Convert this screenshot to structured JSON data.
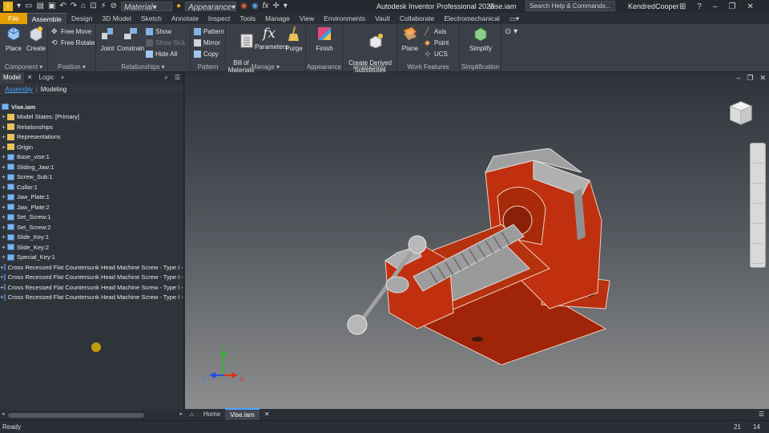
{
  "titlebar": {
    "material": "Material",
    "appearance": "Appearance",
    "app_title": "Autodesk Inventor Professional 2025",
    "file_title": "Vise.iam",
    "search_placeholder": "Search Help & Commands...",
    "user": "KendredCooper"
  },
  "ribbon_tabs": [
    "File",
    "Assemble",
    "Design",
    "3D Model",
    "Sketch",
    "Annotate",
    "Inspect",
    "Tools",
    "Manage",
    "View",
    "Environments",
    "Vault",
    "Collaborate",
    "Electromechanical"
  ],
  "ribbon": {
    "component": {
      "label": "Component",
      "place": "Place",
      "create": "Create"
    },
    "position": {
      "label": "Position",
      "free_move": "Free Move",
      "free_rotate": "Free Rotate"
    },
    "relationships": {
      "label": "Relationships",
      "joint": "Joint",
      "constrain": "Constrain",
      "show": "Show",
      "show_sick": "Show Sick",
      "hide_all": "Hide All"
    },
    "pattern": {
      "label": "Pattern",
      "pattern": "Pattern",
      "mirror": "Mirror",
      "copy": "Copy"
    },
    "manage": {
      "label": "Manage",
      "bom": "Bill of\nMaterials",
      "parameters": "Parameters",
      "purge": "Purge"
    },
    "appearance": {
      "label": "Appearance",
      "finish": "Finish"
    },
    "productivity": {
      "label": "Productivity",
      "create_derived": "Create Derived\nSubstitutes"
    },
    "work_features": {
      "label": "Work Features",
      "plane": "Plane",
      "axis": "Axis",
      "point": "Point",
      "ucs": "UCS"
    },
    "simplification": {
      "label": "Simplification",
      "simplify": "Simplify"
    }
  },
  "browser": {
    "tabs": [
      "Model",
      "Logic"
    ],
    "subtab_assembly": "Assembly",
    "subtab_modeling": "Modeling",
    "root": "Vise.iam",
    "items": [
      {
        "label": "Model States: [Primary]",
        "type": "folder"
      },
      {
        "label": "Relationships",
        "type": "folder"
      },
      {
        "label": "Representations",
        "type": "folder"
      },
      {
        "label": "Origin",
        "type": "folder"
      },
      {
        "label": "Base_vise:1",
        "type": "part"
      },
      {
        "label": "Sliding_Jaw:1",
        "type": "part"
      },
      {
        "label": "Screw_Sub:1",
        "type": "part"
      },
      {
        "label": "Collar:1",
        "type": "part"
      },
      {
        "label": "Jaw_Plate:1",
        "type": "part"
      },
      {
        "label": "Jaw_Plate:2",
        "type": "part"
      },
      {
        "label": "Set_Screw:1",
        "type": "part"
      },
      {
        "label": "Set_Screw:2",
        "type": "part"
      },
      {
        "label": "Slide_Key:1",
        "type": "part"
      },
      {
        "label": "Slide_Key:2",
        "type": "part"
      },
      {
        "label": "Special_Key:1",
        "type": "part"
      },
      {
        "label": "Cross Recessed Flat Countersunk Head Machine Screw - Type I - Inc",
        "type": "part"
      },
      {
        "label": "Cross Recessed Flat Countersunk Head Machine Screw - Type I - Inc",
        "type": "part"
      },
      {
        "label": "Cross Recessed Flat Countersunk Head Machine Screw - Type I - Inc",
        "type": "part"
      },
      {
        "label": "Cross Recessed Flat Countersunk Head Machine Screw - Type I - Inc",
        "type": "part"
      }
    ]
  },
  "document_tabs": [
    "Home",
    "Vise.iam"
  ],
  "status": {
    "text": "Ready",
    "num1": "21",
    "num2": "14"
  },
  "axes": {
    "x": "X",
    "y": "Y",
    "z": "Z"
  },
  "colors": {
    "file_tab": "#e5a000",
    "part_red": "#c0300f",
    "accent": "#4aa3ff"
  }
}
